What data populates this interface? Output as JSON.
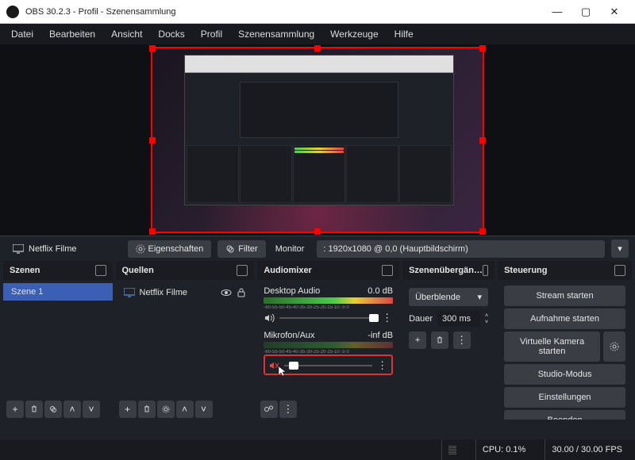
{
  "window": {
    "title": "OBS 30.2.3 - Profil  - Szenensammlung"
  },
  "menu": [
    "Datei",
    "Bearbeiten",
    "Ansicht",
    "Docks",
    "Profil",
    "Szenensammlung",
    "Werkzeuge",
    "Hilfe"
  ],
  "toolbar": {
    "source": "Netflix Filme",
    "props": "Eigenschaften",
    "filter": "Filter",
    "monitor_label": "Monitor",
    "monitor_value": ": 1920x1080 @ 0,0 (Hauptbildschirm)"
  },
  "panels": {
    "scenes_title": "Szenen",
    "sources_title": "Quellen",
    "mixer_title": "Audiomixer",
    "transitions_title": "Szenenübergän…",
    "controls_title": "Steuerung"
  },
  "scenes": [
    "Szene 1"
  ],
  "sources": [
    {
      "name": "Netflix Filme"
    }
  ],
  "mixer": {
    "tracks": [
      {
        "name": "Desktop Audio",
        "db": "0.0 dB",
        "scale": "-60-55-50-45-40-35-30-25-20-15-10 -5 0",
        "slider_pos": "92%",
        "muted": false
      },
      {
        "name": "Mikrofon/Aux",
        "db": "-inf dB",
        "scale": "-60-55-50-45-40-35-30-25-20-15-10 -5 0",
        "slider_pos": "5%",
        "muted": true
      }
    ]
  },
  "transitions": {
    "type": "Überblende",
    "duration_label": "Dauer",
    "duration_value": "300 ms"
  },
  "controls": {
    "stream": "Stream starten",
    "record": "Aufnahme starten",
    "vcam": "Virtuelle Kamera starten",
    "studio": "Studio-Modus",
    "settings": "Einstellungen",
    "exit": "Beenden"
  },
  "status": {
    "cpu": "CPU: 0.1%",
    "fps": "30.00 / 30.00 FPS"
  }
}
